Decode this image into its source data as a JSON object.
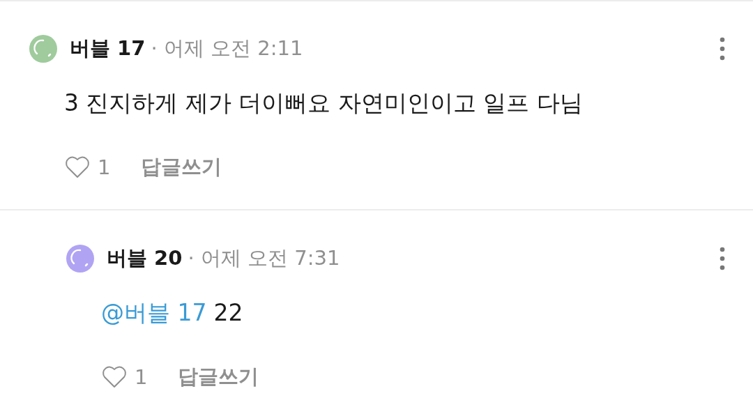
{
  "comments": [
    {
      "kind": "comment",
      "color": "#9fcb9d",
      "author": "버블 17",
      "time": "· 어제 오전 2:11",
      "text": "3 진지하게 제가 더이뻐요 자연미인이고 일프 다님",
      "likes": "1",
      "reply_label": "답글쓰기"
    },
    {
      "kind": "reply",
      "color": "#b1a3f3",
      "author": "버블 20",
      "time": "· 어제 오전 7:31",
      "mention": "@버블 17",
      "text": "22",
      "likes": "1",
      "reply_label": "답글쓰기"
    }
  ]
}
